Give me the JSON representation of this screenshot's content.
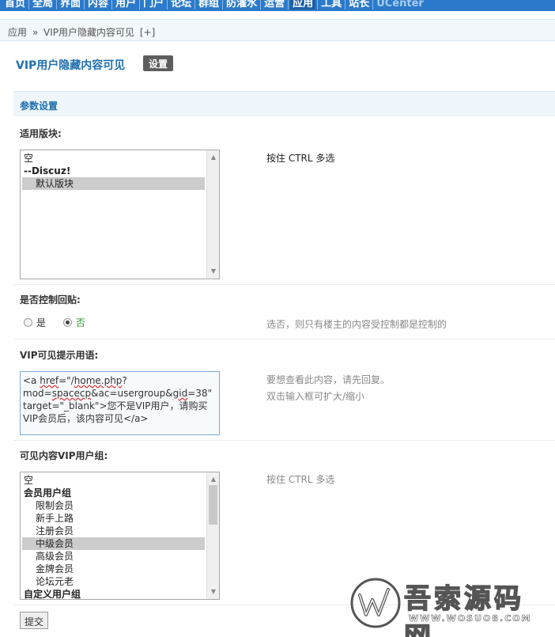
{
  "topnav": {
    "items": [
      "首页",
      "全局",
      "界面",
      "内容",
      "用户",
      "门户",
      "论坛",
      "群组",
      "防灌水",
      "运营",
      "应用",
      "工具",
      "站长",
      "UCenter"
    ],
    "active_index": 10
  },
  "breadcrumb": {
    "root": "应用",
    "separator": "»",
    "current": "VIP用户隐藏内容可见",
    "add": "[+]"
  },
  "page": {
    "title": "VIP用户隐藏内容可见",
    "settings_label": "设置"
  },
  "section": {
    "title": "参数设置"
  },
  "forums": {
    "label": "适用版块:",
    "options": [
      {
        "text": "空",
        "type": "plain"
      },
      {
        "text": "--Discuz!",
        "type": "group"
      },
      {
        "text": "默认版块",
        "type": "indent",
        "selected": true
      }
    ],
    "hint": "按住 CTRL 多选"
  },
  "control_reply": {
    "label": "是否控制回贴:",
    "yes_label": "是",
    "no_label": "否",
    "selected": "no",
    "hint": "选否，则只有楼主的内容受控制都是控制的"
  },
  "vip_prompt": {
    "label": "VIP可见提示用语:",
    "line1_pre": "<a ",
    "line1_u1": "href",
    "line1_mid": "=\"/",
    "line1_u2": "home.php",
    "line1_post": "?",
    "line2_a": "mod=",
    "line2_u1": "spacecp",
    "line2_b": "&ac=usergroup&",
    "line2_u2": "gid",
    "line2_c": "=38\"",
    "line3": "target=\"_blank\">您不是VIP用户，请购买",
    "line4": "VIP会员后，该内容可见</a>",
    "hint_line1": "要想查看此内容，请先回复。",
    "hint_line2": "双击输入框可扩大/缩小"
  },
  "vip_groups": {
    "label": "可见内容VIP用户组:",
    "options": [
      {
        "text": "空",
        "type": "plain"
      },
      {
        "text": "会员用户组",
        "type": "group"
      },
      {
        "text": "限制会员",
        "type": "indent"
      },
      {
        "text": "新手上路",
        "type": "indent"
      },
      {
        "text": "注册会员",
        "type": "indent"
      },
      {
        "text": "中级会员",
        "type": "indent",
        "selected": true
      },
      {
        "text": "高级会员",
        "type": "indent"
      },
      {
        "text": "金牌会员",
        "type": "indent"
      },
      {
        "text": "论坛元老",
        "type": "indent"
      },
      {
        "text": "自定义用户组",
        "type": "group"
      }
    ],
    "hint": "按住 CTRL 多选"
  },
  "submit_label": "提交",
  "watermark": {
    "title": "吾索源码网",
    "subtitle": "WWW.WOSUO8.COM"
  },
  "colors": {
    "nav_bg": "#2b7acb",
    "title_blue": "#1f6fae",
    "section_bg": "#eef5fb",
    "selected_option": "#cccccc",
    "radio_on_label": "#2e9a2e"
  }
}
